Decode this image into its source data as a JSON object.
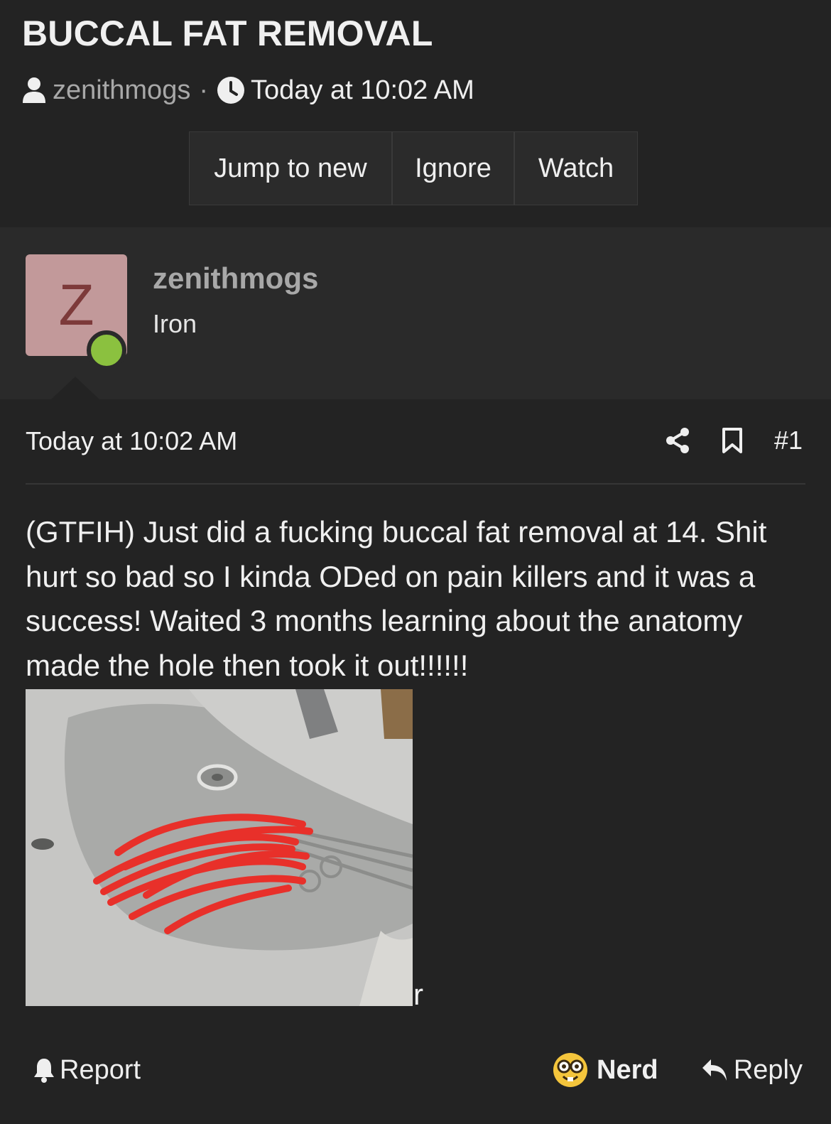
{
  "thread": {
    "title": "BUCCAL FAT REMOVAL",
    "author": "zenithmogs",
    "separator": "·",
    "time": "Today at 10:02 AM",
    "buttons": {
      "jump": "Jump to new",
      "ignore": "Ignore",
      "watch": "Watch"
    }
  },
  "user": {
    "avatar_letter": "Z",
    "name": "zenithmogs",
    "title": "Iron",
    "online": true
  },
  "post": {
    "date": "Today at 10:02 AM",
    "number": "#1",
    "body": "(GTFIH) Just did a fucking buccal fat removal at 14. Shit hurt so bad so I kinda ODed on pain killers and it was a success! Waited 3 months learning about the anatomy made the hole then took it out!!!!!!",
    "trailing": "r"
  },
  "footer": {
    "report": "Report",
    "reaction": "Nerd",
    "reply": "Reply"
  },
  "colors": {
    "background": "#232323",
    "panel": "#2a2a2a",
    "avatar_bg": "#c2999a",
    "avatar_letter": "#7d3a3a",
    "online": "#8bc13f",
    "muted_text": "#a8a8a8",
    "scribble": "#e8302a"
  },
  "icons": [
    "user-icon",
    "clock-icon",
    "share-icon",
    "bookmark-icon",
    "bell-icon",
    "nerd-face-icon",
    "reply-icon"
  ]
}
